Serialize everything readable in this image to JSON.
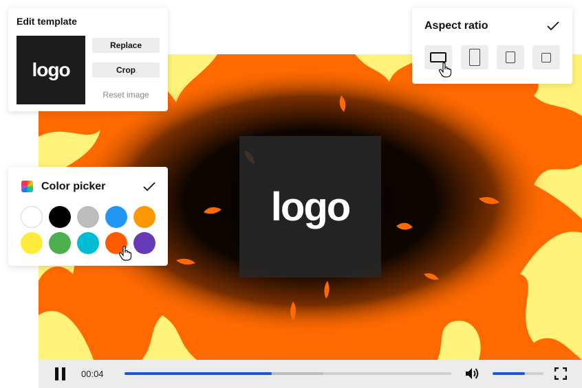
{
  "edit_template": {
    "title": "Edit template",
    "logo_text": "logo",
    "replace_label": "Replace",
    "crop_label": "Crop",
    "reset_label": "Reset image"
  },
  "aspect_ratio": {
    "title": "Aspect ratio",
    "selected_index": 0,
    "options": [
      "landscape-16-9-icon",
      "portrait-9-16-icon",
      "portrait-4-5-icon",
      "square-1-1-icon"
    ]
  },
  "color_picker": {
    "title": "Color picker",
    "selected_index": 8,
    "swatches": [
      "#ffffff",
      "#000000",
      "#bdbdbd",
      "#2196f3",
      "#ff9800",
      "#ffeb3b",
      "#4caf50",
      "#00bcd4",
      "#ff5a00",
      "#673ab7"
    ]
  },
  "video": {
    "logo_text": "logo",
    "time": "00:04",
    "progress": 0.45,
    "buffered": 0.61,
    "volume": 0.63
  },
  "colors": {
    "accent": "#1a55e6",
    "fire_orange": "#ff6a00",
    "fire_yellow": "#fff27a"
  }
}
